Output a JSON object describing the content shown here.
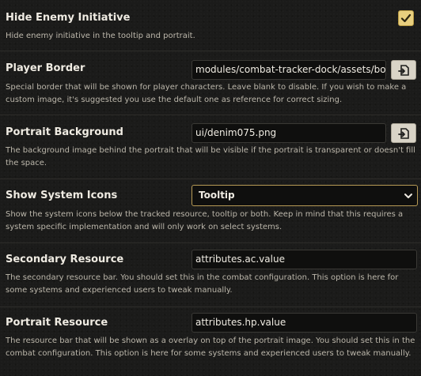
{
  "settings": {
    "hide_enemy_initiative": {
      "label": "Hide Enemy Initiative",
      "hint": "Hide enemy initiative in the tooltip and portrait.",
      "checked": true
    },
    "player_border": {
      "label": "Player Border",
      "value": "modules/combat-tracker-dock/assets/border.png",
      "hint": "Special border that will be shown for player characters. Leave blank to disable. If you wish to make a custom image, it's suggested you use the default one as reference for correct sizing.",
      "button_icon": "file-picker-icon"
    },
    "portrait_background": {
      "label": "Portrait Background",
      "value": "ui/denim075.png",
      "hint": "The background image behind the portrait that will be visible if the portrait is transparent or doesn't fill the space.",
      "button_icon": "file-picker-icon"
    },
    "show_system_icons": {
      "label": "Show System Icons",
      "selected": "Tooltip",
      "hint": "Show the system icons below the tracked resource, tooltip or both. Keep in mind that this requires a system specific implementation and will only work on select systems."
    },
    "secondary_resource": {
      "label": "Secondary Resource",
      "value": "attributes.ac.value",
      "hint": "The secondary resource bar. You should set this in the combat configuration. This option is here for some systems and experienced users to tweak manually."
    },
    "portrait_resource": {
      "label": "Portrait Resource",
      "value": "attributes.hp.value",
      "hint": "The resource bar that will be shown as a overlay on top of the portrait image. You should set this in the combat configuration. This option is here for some systems and experienced users to tweak manually."
    }
  },
  "colors": {
    "background": "#1b1b1a",
    "accent_gold": "#e8cf7e",
    "select_border": "#b79a55",
    "field_bg": "#0f0f0e",
    "text": "#efebe2",
    "hint_text": "#bcb7ab"
  }
}
